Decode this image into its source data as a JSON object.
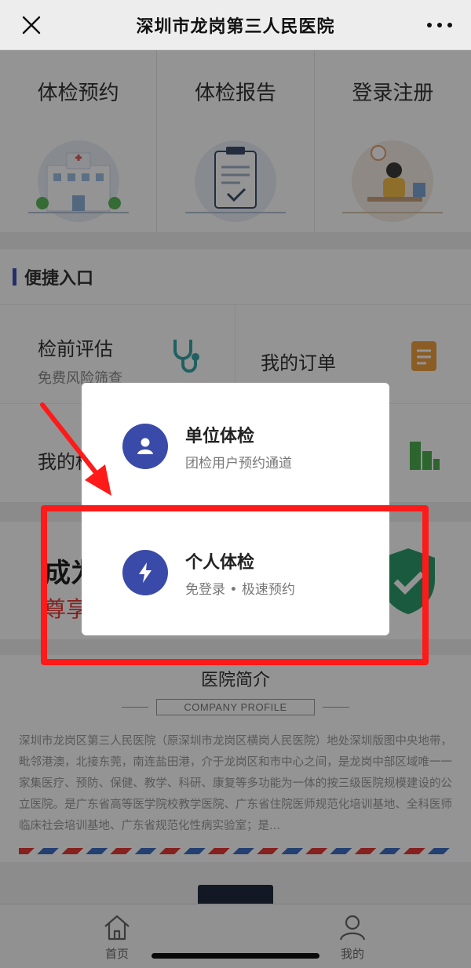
{
  "header": {
    "title": "深圳市龙岗第三人民医院"
  },
  "top_cards": [
    {
      "label": "体检预约"
    },
    {
      "label": "体检报告"
    },
    {
      "label": "登录注册"
    }
  ],
  "quick": {
    "title": "便捷入口",
    "items": [
      {
        "label": "检前评估",
        "sub": "免费风险筛查",
        "icon": "stethoscope-icon"
      },
      {
        "label": "我的订单",
        "sub": "",
        "icon": "clipboard-icon"
      },
      {
        "label": "我的档",
        "sub": "",
        "icon": ""
      },
      {
        "label": "",
        "sub": "",
        "icon": "building-icon"
      }
    ]
  },
  "promo": {
    "line1": "成为",
    "line2": "尊享"
  },
  "profile": {
    "title": "医院简介",
    "subtitle": "COMPANY PROFILE",
    "description": "深圳市龙岗区第三人民医院（原深圳市龙岗区横岗人民医院）地处深圳版图中央地带，毗邻港澳，北接东莞，南连盐田港，介于龙岗区和市中心之间，是龙岗中部区域唯一一家集医疗、预防、保健、教学、科研、康复等多功能为一体的按三级医院规模建设的公立医院。是广东省高等医学院校教学医院、广东省住院医师规范化培训基地、全科医师临床社会培训基地、广东省规范化性病实验室；是..."
  },
  "bottom_nav": [
    {
      "label": "首页",
      "icon": "home-icon"
    },
    {
      "label": "我的",
      "icon": "user-icon"
    }
  ],
  "modal": {
    "options": [
      {
        "title": "单位体检",
        "sub": "团检用户预约通道",
        "icon": "user-icon"
      },
      {
        "title": "个人体检",
        "sub": "免登录 • 极速预约",
        "icon": "lightning-icon"
      }
    ]
  },
  "colors": {
    "accent": "#3a4aa8",
    "annotation": "#ff1a1a",
    "promo_red": "#e53935"
  }
}
